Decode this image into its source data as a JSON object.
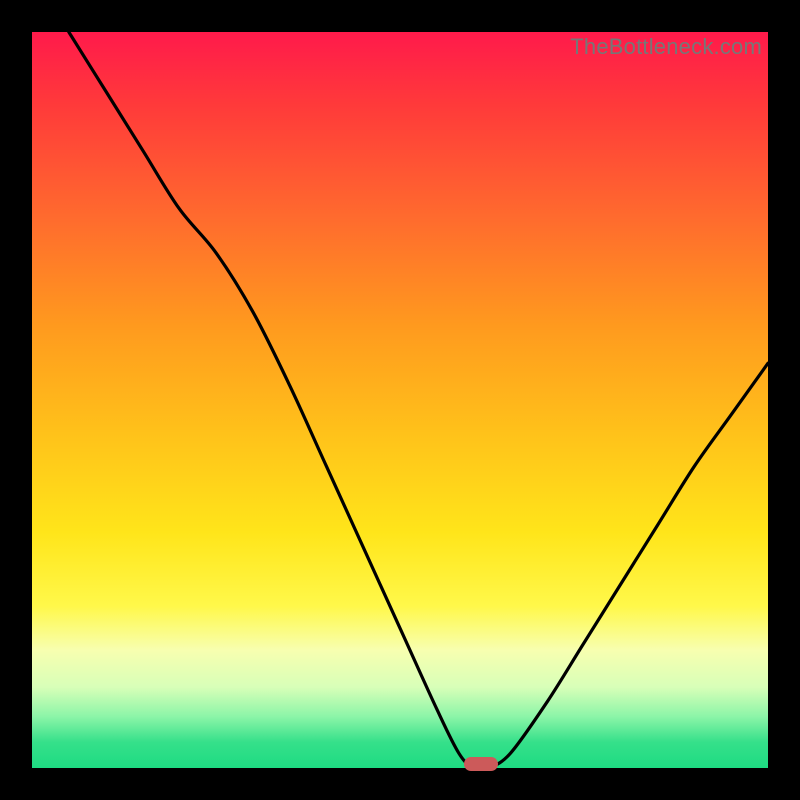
{
  "watermark": "TheBottleneck.com",
  "chart_data": {
    "type": "line",
    "title": "",
    "xlabel": "",
    "ylabel": "",
    "xlim": [
      0,
      100
    ],
    "ylim": [
      0,
      100
    ],
    "grid": false,
    "series": [
      {
        "name": "bottleneck-curve",
        "x": [
          5,
          10,
          15,
          20,
          25,
          30,
          35,
          40,
          45,
          50,
          55,
          58,
          60,
          62,
          65,
          70,
          75,
          80,
          85,
          90,
          95,
          100
        ],
        "y": [
          100,
          92,
          84,
          76,
          70,
          62,
          52,
          41,
          30,
          19,
          8,
          2,
          0,
          0,
          2,
          9,
          17,
          25,
          33,
          41,
          48,
          55
        ]
      }
    ],
    "annotations": [
      {
        "name": "optimal-marker",
        "x": 61,
        "y": 0.5
      }
    ],
    "background_gradient": {
      "top": "#ff1a4b",
      "upper_mid": "#ffc31a",
      "lower_mid": "#fff84a",
      "bottom": "#1edb82"
    }
  }
}
